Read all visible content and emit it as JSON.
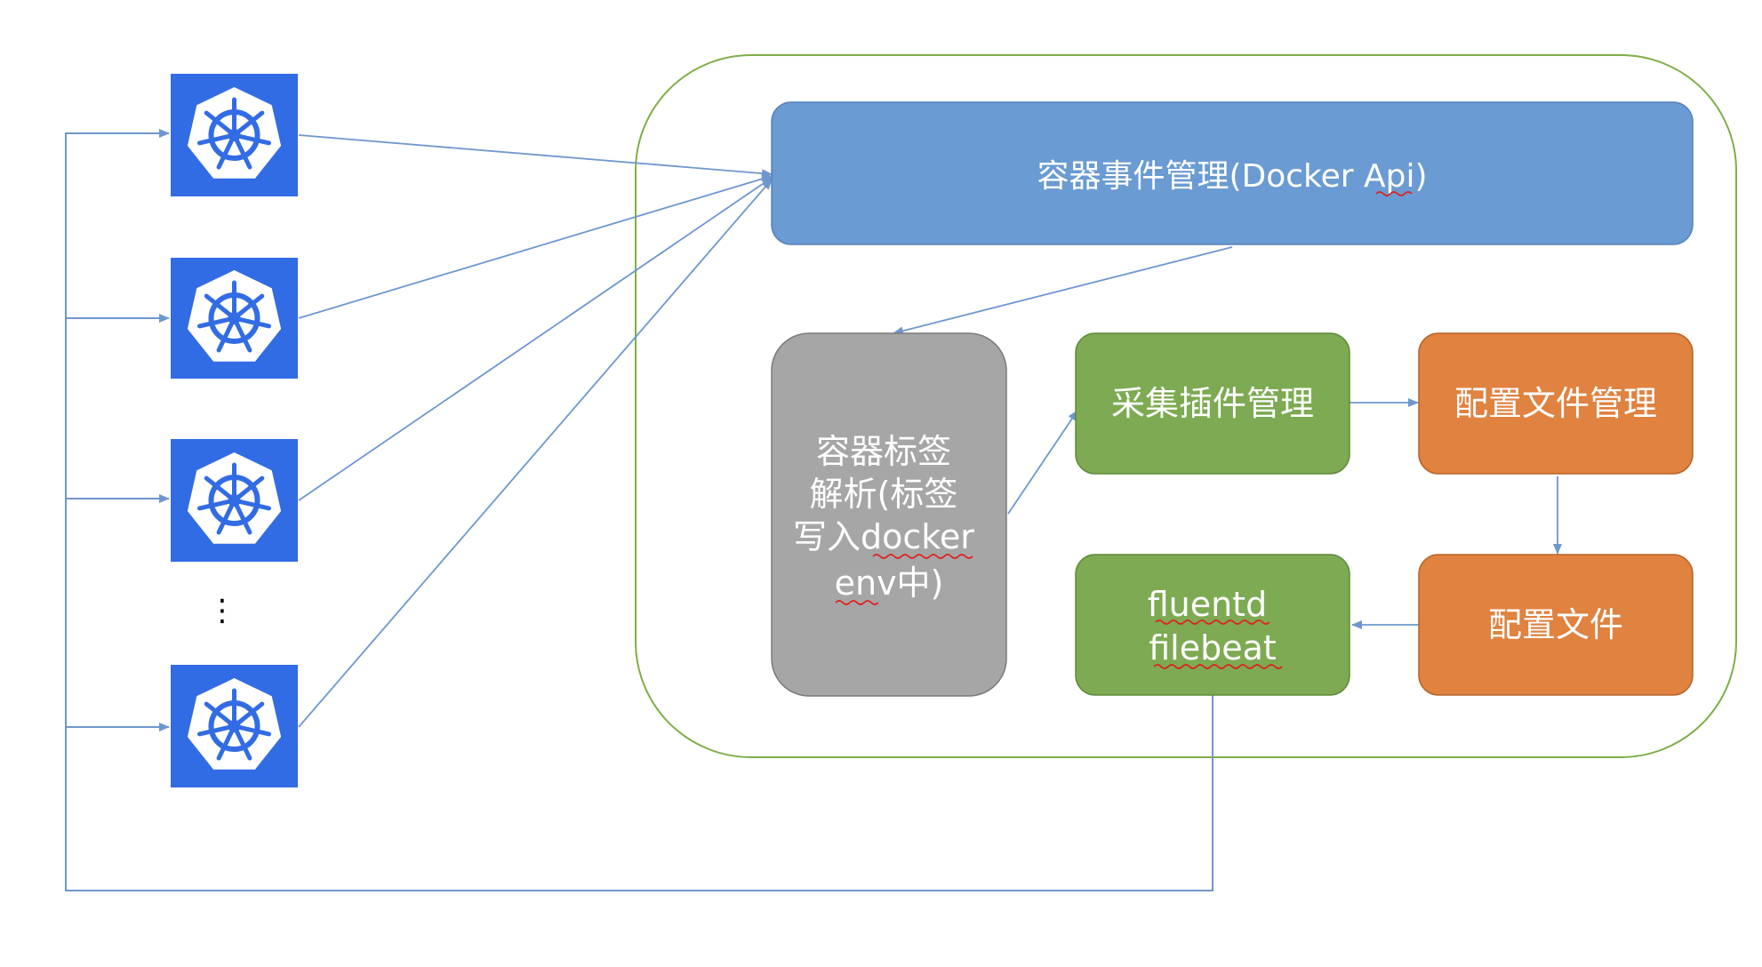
{
  "colors": {
    "k8s_blue": "#326CE5",
    "api_blue": "#6A9BD2",
    "gray": "#A6A6A6",
    "green": "#7DAA52",
    "orange": "#E08240",
    "outline_green": "#7FAE48",
    "arrow": "#6F97CF",
    "spellcheck": "#e02020"
  },
  "nodes": {
    "k8s_icon": "kubernetes-helm-icon",
    "ellipsis": "⋮"
  },
  "boxes": {
    "docker_api": {
      "label": "容器事件管理(Docker Api)"
    },
    "label_parse": {
      "lines": [
        "容器标签",
        "解析(标签",
        "写入docker",
        "env中)"
      ]
    },
    "plugin_mgmt": {
      "label": "采集插件管理"
    },
    "config_mgmt": {
      "label": "配置文件管理"
    },
    "config_file": {
      "label": "配置文件"
    },
    "collectors": {
      "lines": [
        "fluentd",
        "filebeat"
      ]
    }
  }
}
